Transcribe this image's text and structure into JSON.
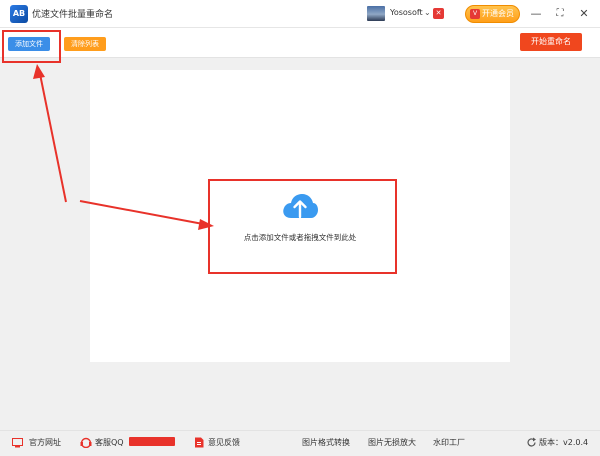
{
  "titlebar": {
    "logo_text": "AB",
    "app_title": "优速文件批量重命名",
    "username": "Yososoft",
    "vip_label": "开通会员",
    "minimize": "—",
    "maximize": "⛶",
    "close": "✕"
  },
  "toolbar": {
    "add_label": "添加文件",
    "clear_label": "清除列表",
    "start_label": "开始重命名"
  },
  "dropzone": {
    "hint": "点击添加文件或者拖拽文件到此处"
  },
  "footer": {
    "website": "官方网址",
    "qq": "客服QQ",
    "feedback": "意见反馈",
    "format_convert": "图片格式转换",
    "lossless_zoom": "图片无损放大",
    "watermark": "水印工厂",
    "version_label": "版本：v2.0.4"
  },
  "colors": {
    "accent_blue": "#3b8ee8",
    "accent_orange": "#ff9d1c",
    "start_red": "#f0471e",
    "annotation_red": "#e8322a"
  },
  "icons": {
    "logo": "app-logo-icon",
    "crown": "crown-icon",
    "cloud": "cloud-upload-icon",
    "website": "monitor-icon",
    "qq": "headset-icon",
    "feedback": "feedback-doc-icon",
    "refresh": "refresh-icon"
  }
}
